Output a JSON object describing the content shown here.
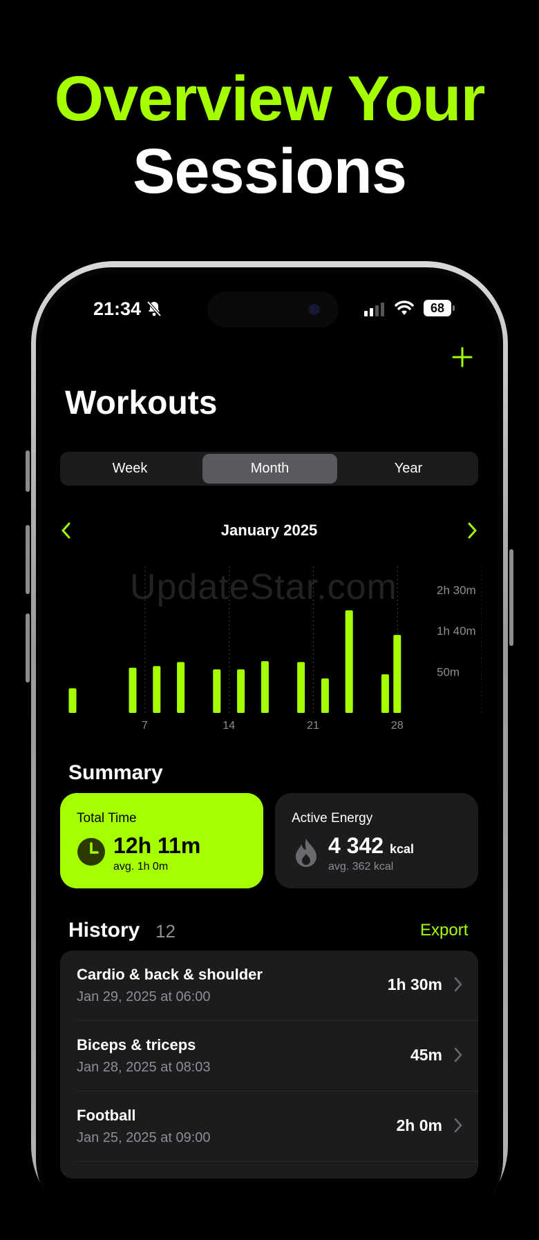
{
  "headline": {
    "line1": "Overview Your",
    "line2": "Sessions"
  },
  "status_bar": {
    "time": "21:34",
    "battery": "68"
  },
  "page": {
    "title": "Workouts"
  },
  "segments": {
    "items": [
      "Week",
      "Month",
      "Year"
    ],
    "selected": "Month"
  },
  "period": {
    "label": "January 2025"
  },
  "watermark": "UpdateStar.com",
  "chart_data": {
    "type": "bar",
    "x": [
      1,
      6,
      8,
      10,
      13,
      15,
      17,
      20,
      22,
      24,
      27,
      28
    ],
    "values": [
      30,
      55,
      57,
      62,
      53,
      53,
      63,
      62,
      42,
      125,
      47,
      95
    ],
    "unit": "min",
    "ylim": [
      0,
      170
    ],
    "y_ticks": [
      "2h 30m",
      "1h 40m",
      "50m"
    ],
    "x_ticks": [
      "7",
      "14",
      "21",
      "28"
    ],
    "colors": {
      "bar": "#A6FF00",
      "grid": "#3a3a3c"
    }
  },
  "summary": {
    "title": "Summary",
    "total_time": {
      "label": "Total Time",
      "value": "12h 11m",
      "avg": "avg. 1h 0m"
    },
    "active_energy": {
      "label": "Active Energy",
      "value": "4 342",
      "unit": "kcal",
      "avg": "avg. 362 kcal"
    }
  },
  "history": {
    "title": "History",
    "count": "12",
    "export_label": "Export",
    "items": [
      {
        "name": "Cardio & back & shoulder",
        "date": "Jan 29, 2025 at 06:00",
        "duration": "1h 30m"
      },
      {
        "name": "Biceps & triceps",
        "date": "Jan 28, 2025 at 08:03",
        "duration": "45m"
      },
      {
        "name": "Football",
        "date": "Jan 25, 2025 at 09:00",
        "duration": "2h 0m"
      }
    ]
  },
  "colors": {
    "accent": "#A6FF00",
    "background": "#000000",
    "card": "#1c1c1e",
    "secondary_text": "#8e8e93"
  }
}
